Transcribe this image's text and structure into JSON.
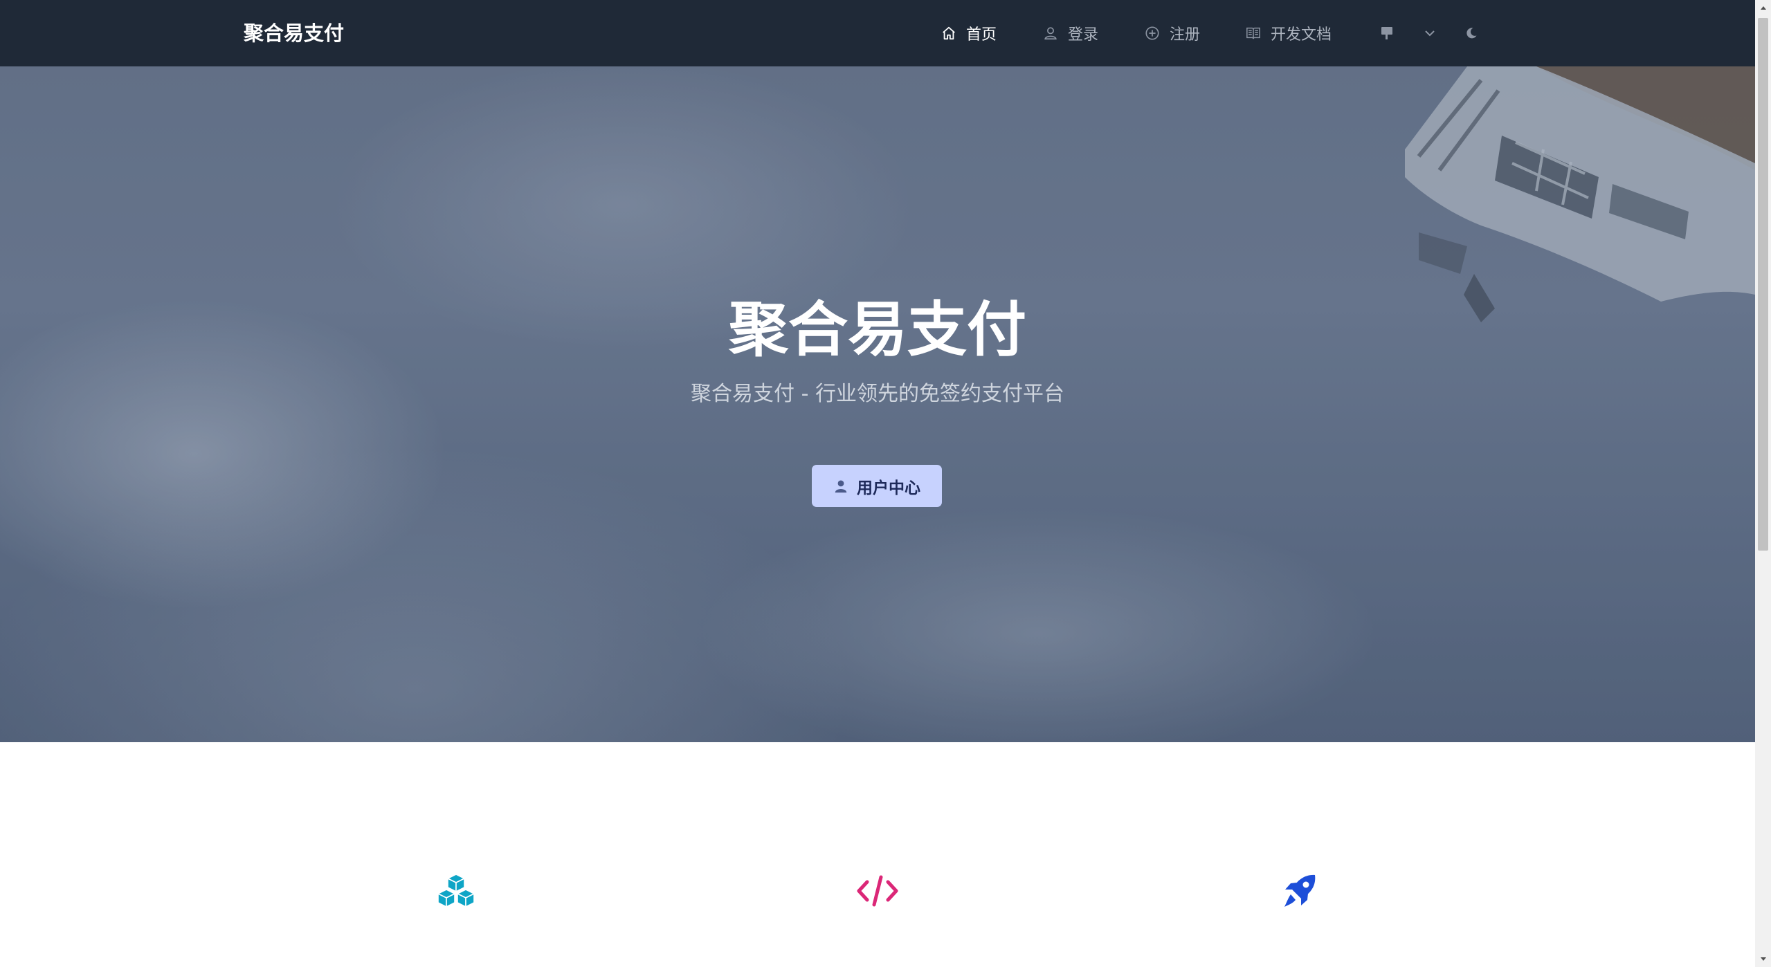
{
  "navbar": {
    "brand": "聚合易支付",
    "items": [
      {
        "label": "首页",
        "icon": "home-icon",
        "active": true
      },
      {
        "label": "登录",
        "icon": "user-icon",
        "active": false
      },
      {
        "label": "注册",
        "icon": "plus-circle-icon",
        "active": false
      },
      {
        "label": "开发文档",
        "icon": "book-icon",
        "active": false
      }
    ],
    "language_icon": "language-flag-icon",
    "theme_icon": "moon-icon"
  },
  "hero": {
    "title": "聚合易支付",
    "subtitle": "聚合易支付 - 行业领先的免签约支付平台",
    "button_label": "用户中心",
    "button_icon": "user-icon"
  },
  "features": [
    {
      "icon": "cubes-icon",
      "color": "#0ea5c6"
    },
    {
      "icon": "code-icon",
      "color": "#db2777"
    },
    {
      "icon": "rocket-icon",
      "color": "#1d4ed8"
    }
  ],
  "colors": {
    "navbar_bg": "#1f2937",
    "button_bg": "#c7d2fe",
    "button_text": "#1e2a5a"
  }
}
